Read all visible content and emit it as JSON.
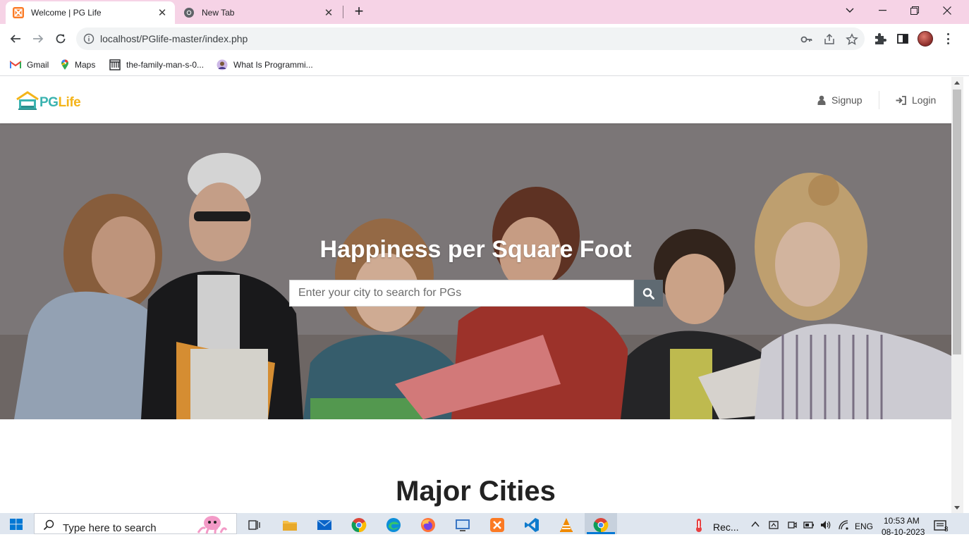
{
  "browser": {
    "tabs": [
      {
        "title": "Welcome | PG Life",
        "active": true
      },
      {
        "title": "New Tab",
        "active": false
      }
    ],
    "url": "localhost/PGlife-master/index.php",
    "bookmarks": [
      {
        "label": "Gmail",
        "icon": "gmail-icon"
      },
      {
        "label": "Maps",
        "icon": "maps-icon"
      },
      {
        "label": "the-family-man-s-0...",
        "icon": "document-icon"
      },
      {
        "label": "What Is Programmi...",
        "icon": "profile-icon"
      }
    ]
  },
  "site": {
    "logo": {
      "text_a": "PG",
      "text_b": "Life"
    },
    "nav": {
      "signup": "Signup",
      "login": "Login"
    },
    "hero": {
      "title": "Happiness per Square Foot",
      "search_placeholder": "Enter your city to search for PGs"
    },
    "section_title": "Major Cities"
  },
  "taskbar": {
    "search_placeholder": "Type here to search",
    "weather": "Rec...",
    "language": "ENG",
    "time": "10:53 AM",
    "date": "08-10-2023",
    "notifications": "8"
  },
  "colors": {
    "tab_strip": "#f6d3e6",
    "logo_teal": "#3bb3b0",
    "logo_orange": "#f4b41a",
    "search_button": "#5f6a72"
  }
}
